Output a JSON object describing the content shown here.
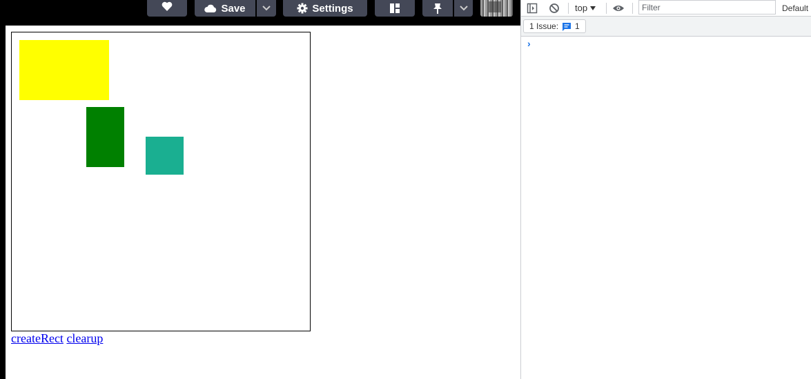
{
  "toolbar": {
    "save_label": "Save",
    "settings_label": "Settings",
    "icons": [
      "heart-icon",
      "cloud-icon",
      "chevron-down-icon",
      "gear-icon",
      "layout-icon",
      "pin-icon",
      "chevron-down-icon"
    ]
  },
  "preview": {
    "rects": [
      {
        "name": "yellow-rect",
        "color": "#ffff00"
      },
      {
        "name": "green-rect",
        "color": "#008000"
      },
      {
        "name": "teal-rect",
        "color": "#1aaf91"
      }
    ],
    "links": {
      "create": "createRect",
      "clear": "clearup"
    }
  },
  "devtools": {
    "context": "top",
    "filter_placeholder": "Filter",
    "levels": "Default",
    "issues_label": "1 Issue:",
    "issues_count": "1",
    "prompt_symbol": "›"
  },
  "colors": {
    "toolbar_button": "#444857",
    "link": "#0000ee",
    "devtools_accent": "#1a73e8"
  }
}
